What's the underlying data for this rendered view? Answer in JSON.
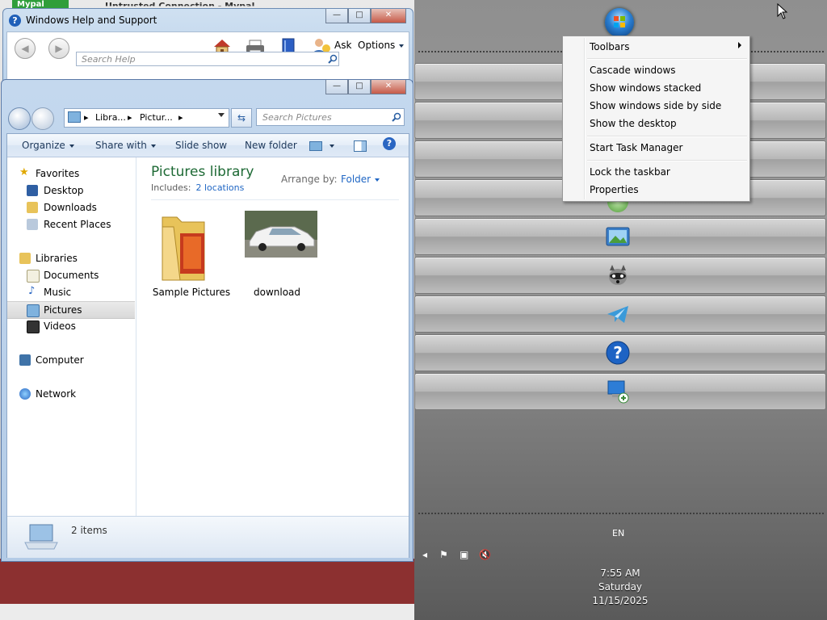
{
  "background_window": {
    "mypal_label": "Mypal",
    "title": "Untrusted Connection - Mypal"
  },
  "help_window": {
    "title": "Windows Help and Support",
    "search_placeholder": "Search Help",
    "ask_label": "Ask",
    "options_label": "Options"
  },
  "explorer": {
    "address": {
      "seg1": "Libra...",
      "seg2": "Pictur..."
    },
    "search_placeholder": "Search Pictures",
    "commands": {
      "organize": "Organize",
      "share": "Share with",
      "slideshow": "Slide show",
      "new_folder": "New folder"
    },
    "nav": {
      "favorites": "Favorites",
      "desktop": "Desktop",
      "downloads": "Downloads",
      "recent": "Recent Places",
      "libraries": "Libraries",
      "documents": "Documents",
      "music": "Music",
      "pictures": "Pictures",
      "videos": "Videos",
      "computer": "Computer",
      "network": "Network"
    },
    "library_title": "Pictures library",
    "includes_label": "Includes:",
    "includes_link": "2 locations",
    "arrange_label": "Arrange by:",
    "arrange_value": "Folder",
    "files": [
      {
        "name": "Sample Pictures"
      },
      {
        "name": "download"
      }
    ],
    "status": "2 items"
  },
  "context_menu": {
    "toolbars": "Toolbars",
    "cascade": "Cascade windows",
    "stacked": "Show windows stacked",
    "side_by_side": "Show windows side by side",
    "show_desktop": "Show the desktop",
    "task_manager": "Start Task Manager",
    "lock_taskbar": "Lock the taskbar",
    "properties": "Properties"
  },
  "taskbar": {
    "language": "EN",
    "time": "7:55 AM",
    "day": "Saturday",
    "date": "11/15/2025"
  },
  "colors": {
    "library_title": "#1e6a35",
    "link": "#1f66c4",
    "help_icon": "#1f5fb8",
    "red_strip": "#8c3030"
  }
}
